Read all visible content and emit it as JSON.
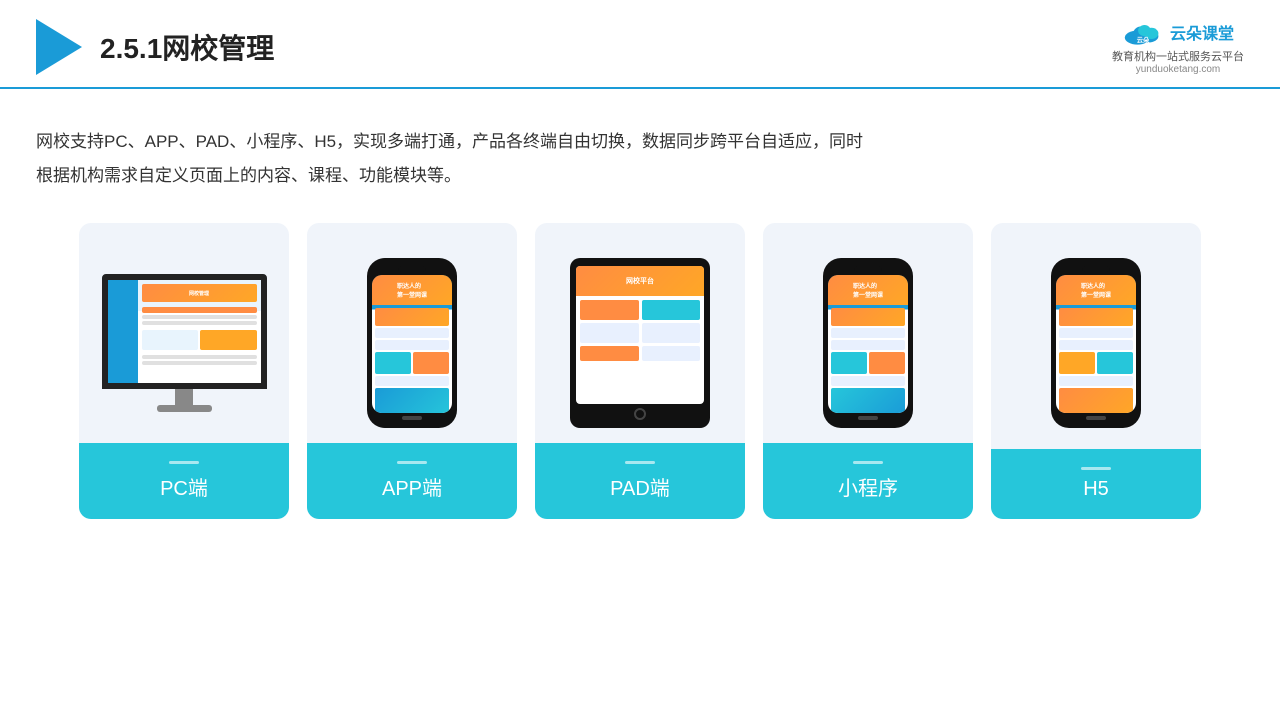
{
  "header": {
    "title": "2.5.1网校管理",
    "brand": {
      "name": "云朵课堂",
      "tagline": "教育机构一站式服务云平台",
      "url": "yunduoketang.com"
    }
  },
  "description": {
    "text": "网校支持PC、APP、PAD、小程序、H5，实现多端打通，产品各终端自由切换，数据同步跨平台自适应，同时根据机构需求自定义页面上的内容、课程、功能模块等。"
  },
  "cards": [
    {
      "id": "pc",
      "label": "PC端",
      "type": "pc"
    },
    {
      "id": "app",
      "label": "APP端",
      "type": "phone"
    },
    {
      "id": "pad",
      "label": "PAD端",
      "type": "tablet"
    },
    {
      "id": "mini-program",
      "label": "小程序",
      "type": "phone"
    },
    {
      "id": "h5",
      "label": "H5",
      "type": "phone"
    }
  ]
}
